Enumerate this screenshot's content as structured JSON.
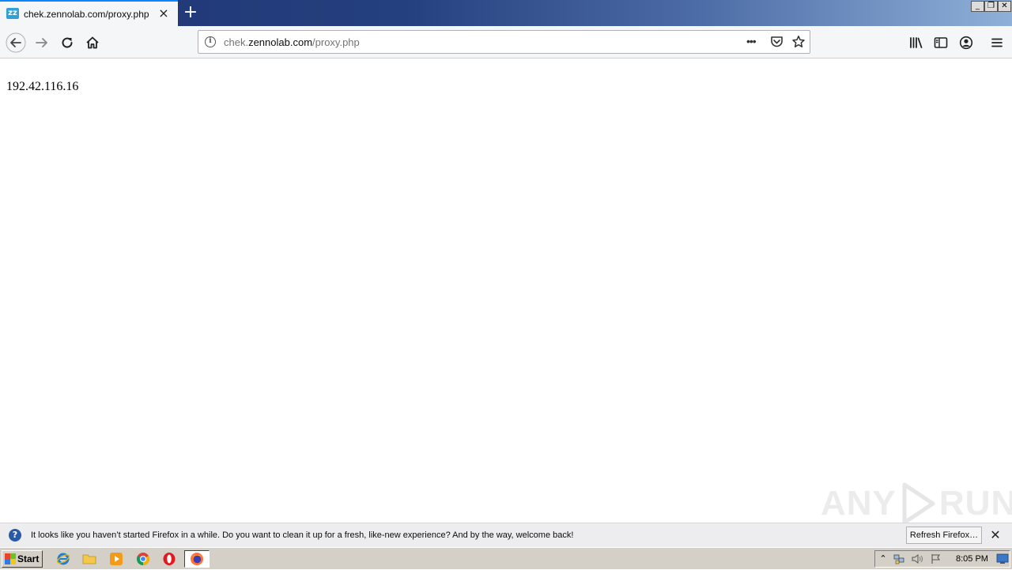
{
  "tab": {
    "title": "chek.zennolab.com/proxy.php",
    "favicon": "zz-icon",
    "close": "×"
  },
  "toolbar": {
    "new_tab": "+"
  },
  "window_controls": {
    "minimize": "_",
    "restore": "❐",
    "close": "✕"
  },
  "urlbar": {
    "prefix": "chek.",
    "host": "zennolab.com",
    "path": "/proxy.php",
    "page_actions": "•••"
  },
  "page": {
    "ip": "192.42.116.16"
  },
  "watermark": {
    "left": "ANY",
    "right": "RUN"
  },
  "notification": {
    "icon": "?",
    "message": "It looks like you haven’t started Firefox in a while. Do you want to clean it up for a fresh, like-new experience? And by the way, welcome back!",
    "button": "Refresh Firefox…",
    "close": "✕"
  },
  "taskbar": {
    "start_label": "Start",
    "clock": "8:05 PM"
  },
  "colors": {
    "accent": "#0a84ff",
    "titlebar_dark": "#1f3573",
    "titlebar_light": "#8fb0d8",
    "toolbar_bg": "#f5f6f7",
    "notif_bg": "#ededf0",
    "taskbar_bg": "#d4d0c8"
  }
}
